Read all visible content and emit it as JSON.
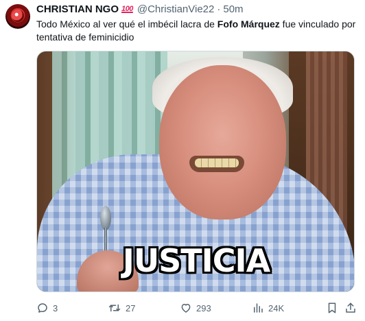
{
  "tweet": {
    "author_name": "CHRISTIAN NGO",
    "badge": "100",
    "handle": "@ChristianVie22",
    "separator": "·",
    "time": "50m",
    "text_before": "Todo México al ver qué el imbécil lacra de ",
    "text_bold": "Fofo Márquez",
    "text_after": " fue vinculado por tentativa de feminicidio"
  },
  "media": {
    "caption": "JUSTICIA"
  },
  "actions": {
    "replies": "3",
    "retweets": "27",
    "likes": "293",
    "views": "24K"
  },
  "icons": {
    "reply": "reply-icon",
    "retweet": "retweet-icon",
    "like": "heart-icon",
    "views": "bar-chart-icon",
    "bookmark": "bookmark-icon",
    "share": "share-icon"
  },
  "colors": {
    "text": "#0f1419",
    "secondary": "#536471",
    "badge": "#e0245e"
  }
}
